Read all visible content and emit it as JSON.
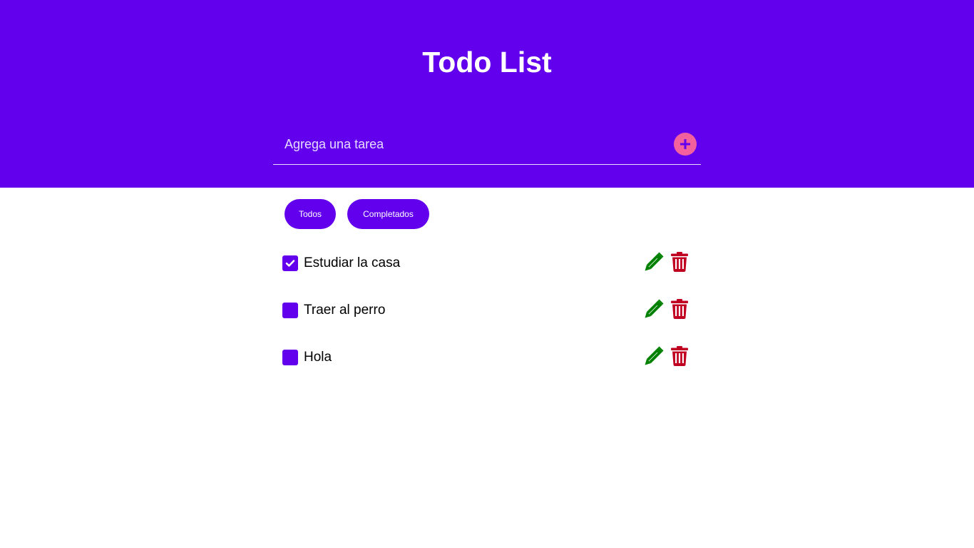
{
  "header": {
    "title": "Todo List",
    "background": "#6200ee"
  },
  "add_task": {
    "placeholder": "Agrega una tarea",
    "value": "",
    "button_icon": "plus-icon",
    "button_color": "#f2609e"
  },
  "filters": [
    {
      "label": "Todos"
    },
    {
      "label": "Completados"
    }
  ],
  "tasks": [
    {
      "label": "Estudiar la casa",
      "completed": true
    },
    {
      "label": "Traer al perro",
      "completed": false
    },
    {
      "label": "Hola",
      "completed": false
    }
  ],
  "icons": {
    "edit": "pencil-icon",
    "delete": "trash-icon",
    "edit_color": "#008000",
    "delete_color": "#c00020"
  }
}
